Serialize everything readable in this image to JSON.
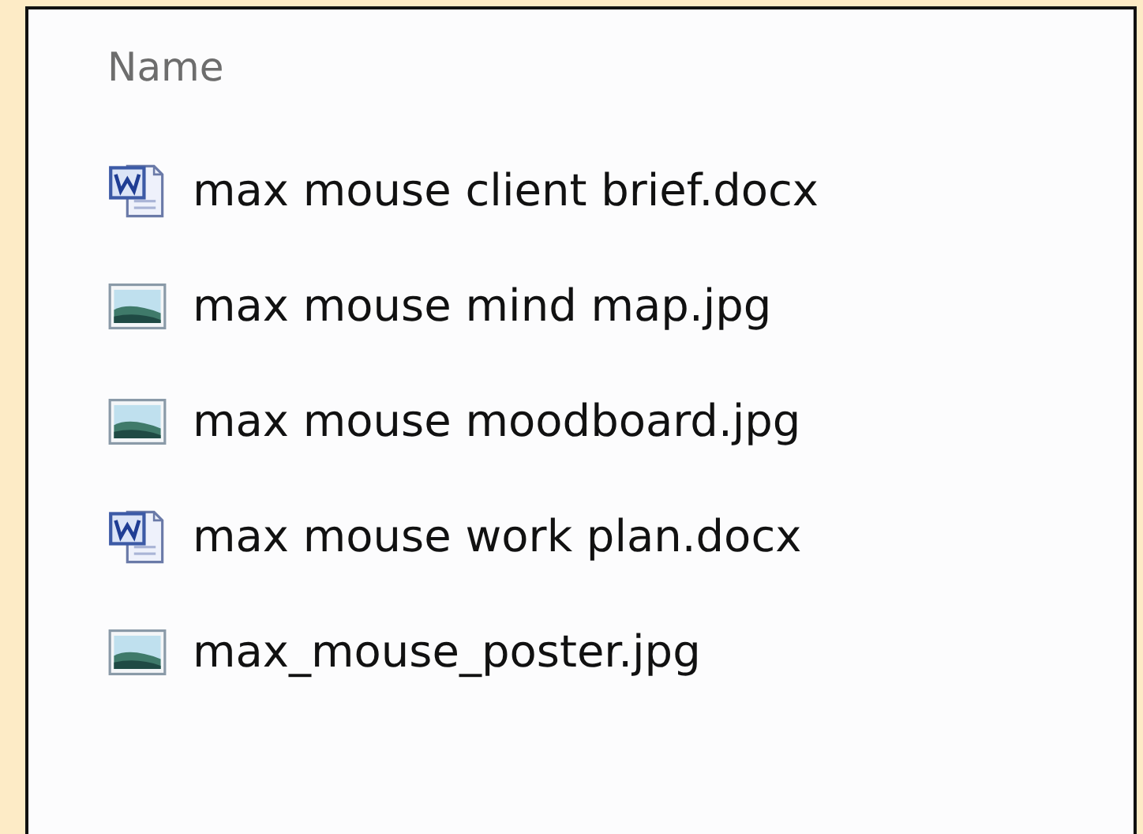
{
  "header": {
    "label": "Name"
  },
  "files": [
    {
      "name": "max mouse client brief.docx",
      "kind": "document"
    },
    {
      "name": "max mouse mind map.jpg",
      "kind": "image"
    },
    {
      "name": "max mouse moodboard.jpg",
      "kind": "image"
    },
    {
      "name": "max mouse work plan.docx",
      "kind": "document"
    },
    {
      "name": "max_mouse_poster.jpg",
      "kind": "image"
    }
  ]
}
